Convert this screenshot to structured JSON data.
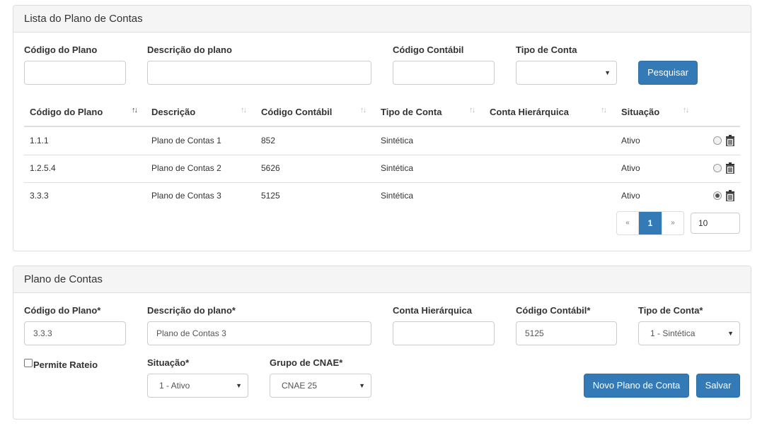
{
  "list_panel": {
    "title": "Lista do Plano de Contas",
    "filters": {
      "codigo_plano_label": "Código do Plano",
      "descricao_label": "Descrição do plano",
      "codigo_contabil_label": "Código Contábil",
      "tipo_conta_label": "Tipo de Conta",
      "tipo_conta_value": "",
      "search_button": "Pesquisar"
    },
    "table": {
      "headers": [
        "Código do Plano",
        "Descrição",
        "Código Contábil",
        "Tipo de Conta",
        "Conta Hierárquica",
        "Situação"
      ],
      "rows": [
        {
          "codigo": "1.1.1",
          "descricao": "Plano de Contas 1",
          "contabil": "852",
          "tipo": "Sintética",
          "hierarquica": "",
          "situacao": "Ativo",
          "selected": false
        },
        {
          "codigo": "1.2.5.4",
          "descricao": "Plano de Contas 2",
          "contabil": "5626",
          "tipo": "Sintética",
          "hierarquica": "",
          "situacao": "Ativo",
          "selected": false
        },
        {
          "codigo": "3.3.3",
          "descricao": "Plano de Contas 3",
          "contabil": "5125",
          "tipo": "Sintética",
          "hierarquica": "",
          "situacao": "Ativo",
          "selected": true
        }
      ]
    },
    "pagination": {
      "prev": "«",
      "current": "1",
      "next": "»",
      "page_size": "10"
    }
  },
  "form_panel": {
    "title": "Plano de Contas",
    "codigo_plano_label": "Código do Plano*",
    "codigo_plano_value": "3.3.3",
    "descricao_label": "Descrição do plano*",
    "descricao_value": "Plano de Contas 3",
    "conta_hierarquica_label": "Conta Hierárquica",
    "conta_hierarquica_value": "",
    "codigo_contabil_label": "Código Contábil*",
    "codigo_contabil_value": "5125",
    "tipo_conta_label": "Tipo de Conta*",
    "tipo_conta_value": "1 - Sintética",
    "permite_rateio_label": "Permite Rateio",
    "situacao_label": "Situação*",
    "situacao_value": "1 - Ativo",
    "grupo_cnae_label": "Grupo de CNAE*",
    "grupo_cnae_value": "CNAE 25",
    "novo_button": "Novo Plano de Conta",
    "salvar_button": "Salvar"
  },
  "colors": {
    "primary": "#337ab7",
    "panel_heading": "#f5f5f5",
    "border": "#dddddd"
  },
  "icons": [
    "sort-icon",
    "trash-icon",
    "caret-down-icon"
  ]
}
